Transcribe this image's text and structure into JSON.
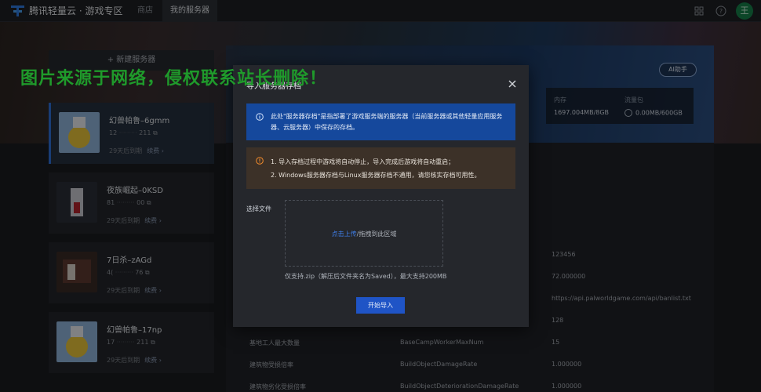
{
  "topbar": {
    "brand": "腾讯轻量云 · 游戏专区",
    "tabs": [
      "商店",
      "我的服务器"
    ],
    "avatar_initial": "王"
  },
  "sidebar": {
    "new_server_label": "+ 新建服务器",
    "servers": [
      {
        "name": "幻兽帕鲁–6gmm",
        "ip_start": "12",
        "ip_end": "211",
        "expire": "29天后到期",
        "renew": "续费 ›"
      },
      {
        "name": "夜族崛起–0KSD",
        "ip_start": "81",
        "ip_end": "00",
        "expire": "29天后到期",
        "renew": "续费 ›"
      },
      {
        "name": "7日杀–zAGd",
        "ip_start": "4(",
        "ip_end": "76",
        "expire": "29天后到期",
        "renew": "续费 ›"
      },
      {
        "name": "幻兽帕鲁–17np",
        "ip_start": "17",
        "ip_end": "211",
        "expire": "29天后到期",
        "renew": "续费 ›"
      }
    ]
  },
  "main": {
    "ai_button": "AI助手",
    "stats": [
      {
        "label": "内存",
        "value": "1697.004MB/8GB"
      },
      {
        "label": "流量包",
        "value": "0.00MB/600GB"
      }
    ],
    "config_rows": [
      {
        "name": "",
        "key": "",
        "value": "123456"
      },
      {
        "name": "",
        "key": "",
        "value": "72.000000"
      },
      {
        "name": "",
        "key": "",
        "value": "https://api.palworldgame.com/api/banlist.txt"
      },
      {
        "name": "",
        "key": "",
        "value": "128"
      },
      {
        "name": "基地工人最大数量",
        "key": "BaseCampWorkerMaxNum",
        "value": "15"
      },
      {
        "name": "建筑物受损倍率",
        "key": "BuildObjectDamageRate",
        "value": "1.000000"
      },
      {
        "name": "建筑物劣化受损倍率",
        "key": "BuildObjectDeteriorationDamageRate",
        "value": "1.000000"
      }
    ]
  },
  "modal": {
    "title": "导入服务器存档",
    "info": "此处\"服务器存档\"是指部署了游戏服务端的服务器（当前服务器或其他轻量应用服务器、云服务器）中保存的存档。",
    "warnings": [
      "1. 导入存档过程中游戏将自动停止，导入完成后游戏将自动重启；",
      "2. Windows服务器存档与Linux服务器存档不通用，请您核实存档可用性。"
    ],
    "field_label": "选择文件",
    "upload_link": "点击上传",
    "upload_text": "/拖拽到此区域",
    "hint": "仅支持.zip（解压后文件夹名为Saved），最大支持200MB",
    "start_button": "开始导入"
  },
  "watermark": "图片来源于网络，侵权联系站长删除！",
  "colors": {
    "accent": "#1f54c6",
    "info_bg": "#15489c",
    "warn_bg": "#3c3128",
    "watermark": "#1f9a2b",
    "avatar": "#16804a"
  }
}
